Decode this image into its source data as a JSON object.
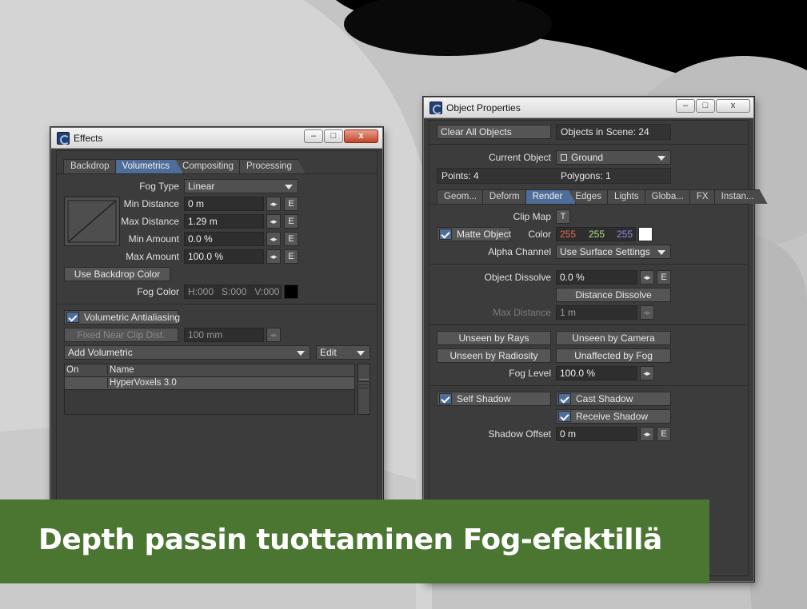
{
  "banner": {
    "title": "Depth passin tuottaminen Fog-efektillä"
  },
  "effects": {
    "title": "Effects",
    "tabs": [
      "Backdrop",
      "Volumetrics",
      "Compositing",
      "Processing"
    ],
    "active_tab": "Volumetrics",
    "fog_type_label": "Fog Type",
    "fog_type": "Linear",
    "min_distance_label": "Min Distance",
    "min_distance": "0 m",
    "max_distance_label": "Max Distance",
    "max_distance": "1.29 m",
    "min_amount_label": "Min Amount",
    "min_amount": "0.0 %",
    "max_amount_label": "Max Amount",
    "max_amount": "100.0 %",
    "envelope_button": "E",
    "use_backdrop_color": "Use Backdrop Color",
    "fog_color_label": "Fog Color",
    "fog_color_h": "H:000",
    "fog_color_s": "S:000",
    "fog_color_v": "V:000",
    "fog_color_swatch": "#000000",
    "volumetric_antialiasing": "Volumetric Antialiasing",
    "fixed_near_clip": "Fixed Near Clip Dist.",
    "near_clip_value": "100 mm",
    "add_volumetric": "Add Volumetric",
    "edit": "Edit",
    "list_headers": {
      "on": "On",
      "name": "Name"
    },
    "list_items": [
      {
        "on": "",
        "name": "HyperVoxels 3.0"
      }
    ]
  },
  "object_properties": {
    "title": "Object Properties",
    "clear_all_objects": "Clear All Objects",
    "objects_in_scene": "Objects in Scene: 24",
    "current_object_label": "Current Object",
    "current_object": "Ground",
    "points": "Points: 4",
    "polygons": "Polygons: 1",
    "tabs": [
      "Geom...",
      "Deform",
      "Render",
      "Edges",
      "Lights",
      "Globa...",
      "FX",
      "Instan..."
    ],
    "active_tab": "Render",
    "clip_map_label": "Clip Map",
    "clip_map_button": "T",
    "matte_object": "Matte Object",
    "color_label": "Color",
    "color_r": "255",
    "color_g": "255",
    "color_b": "255",
    "color_swatch": "#ffffff",
    "alpha_channel_label": "Alpha Channel",
    "alpha_channel": "Use Surface Settings",
    "object_dissolve_label": "Object Dissolve",
    "object_dissolve": "0.0 %",
    "distance_dissolve": "Distance Dissolve",
    "max_distance_label": "Max Distance",
    "max_distance": "1 m",
    "unseen_by_rays": "Unseen by Rays",
    "unseen_by_camera": "Unseen by Camera",
    "unseen_by_radiosity": "Unseen by Radiosity",
    "unaffected_by_fog": "Unaffected by Fog",
    "fog_level_label": "Fog Level",
    "fog_level": "100.0 %",
    "self_shadow": "Self Shadow",
    "cast_shadow": "Cast Shadow",
    "receive_shadow": "Receive Shadow",
    "shadow_offset_label": "Shadow Offset",
    "shadow_offset": "0 m",
    "envelope_button": "E"
  },
  "window_controls": {
    "minimize": "–",
    "maximize": "□",
    "close": "x"
  },
  "colors": {
    "banner": "#4b7632",
    "active_tab": "#4e6d99",
    "panel": "#3c3c3c",
    "color_r": "#e06a5a",
    "color_g": "#a8e07a",
    "color_b": "#8a8ae8"
  }
}
